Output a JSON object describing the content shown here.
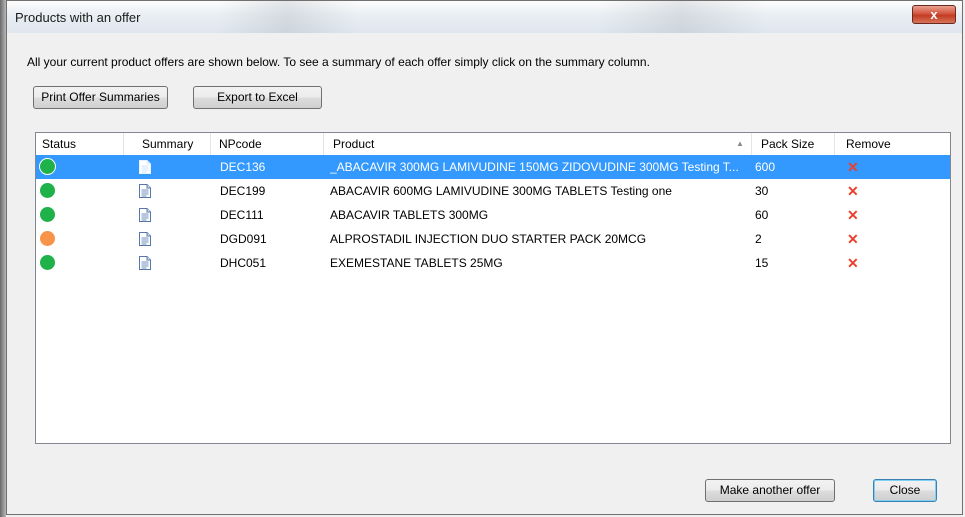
{
  "window": {
    "title": "Products with an offer",
    "close_glyph": "x"
  },
  "info_text": "All your current product offers are shown below. To see a summary of each offer simply click on the summary column.",
  "buttons": {
    "print": "Print Offer Summaries",
    "export": "Export to Excel",
    "make_offer": "Make another offer",
    "close": "Close"
  },
  "table": {
    "columns": [
      "Status",
      "Summary",
      "NPcode",
      "Product",
      "Pack Size",
      "Remove"
    ],
    "sort_column": "Product",
    "rows": [
      {
        "status": "green",
        "npcode": "DEC136",
        "product": "_ABACAVIR 300MG LAMIVUDINE 150MG ZIDOVUDINE 300MG Testing T...",
        "pack_size": "600",
        "selected": true
      },
      {
        "status": "green",
        "npcode": "DEC199",
        "product": "ABACAVIR 600MG LAMIVUDINE 300MG TABLETS Testing one",
        "pack_size": "30",
        "selected": false
      },
      {
        "status": "green",
        "npcode": "DEC111",
        "product": "ABACAVIR TABLETS 300MG",
        "pack_size": "60",
        "selected": false
      },
      {
        "status": "orange",
        "npcode": "DGD091",
        "product": "ALPROSTADIL INJECTION DUO STARTER PACK 20MCG",
        "pack_size": "2",
        "selected": false
      },
      {
        "status": "green",
        "npcode": "DHC051",
        "product": "EXEMESTANE TABLETS 25MG",
        "pack_size": "15",
        "selected": false
      }
    ]
  },
  "icons": {
    "status": "status-dot-icon",
    "summary": "document-icon",
    "remove": "remove-x-icon",
    "sort": "sort-ascending-icon"
  },
  "colors": {
    "green": "#1fb24a",
    "orange": "#f7944a",
    "remove": "#e8412c",
    "selection": "#3399ff"
  }
}
